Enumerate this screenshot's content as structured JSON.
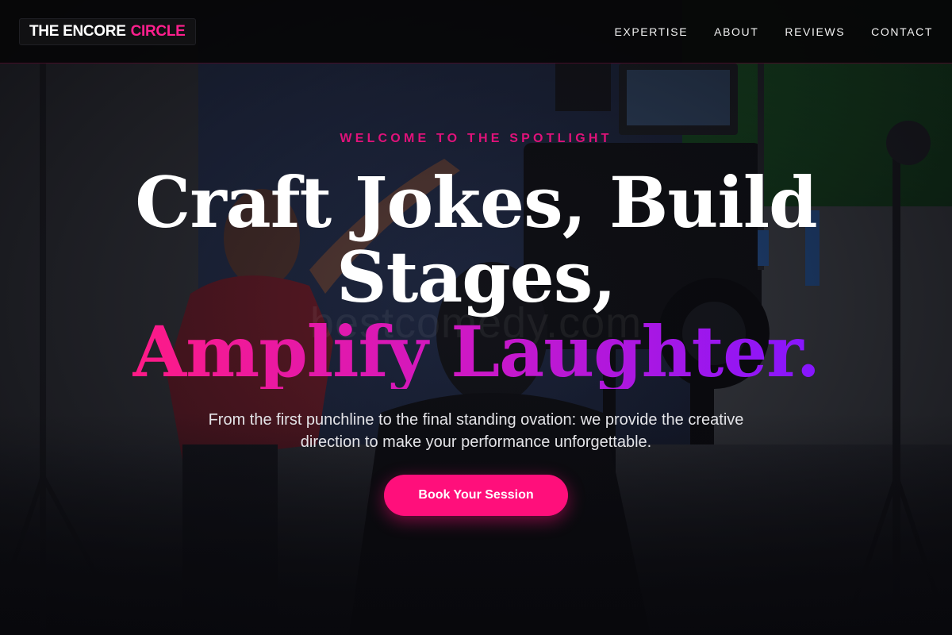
{
  "brand": {
    "name_main": "THE ENCORE",
    "name_accent": "CIRCLE"
  },
  "nav": {
    "items": [
      {
        "label": "EXPERTISE"
      },
      {
        "label": "ABOUT"
      },
      {
        "label": "REVIEWS"
      },
      {
        "label": "CONTACT"
      }
    ]
  },
  "hero": {
    "eyebrow": "WELCOME TO THE SPOTLIGHT",
    "headline_line1": "Craft Jokes, Build",
    "headline_line2": "Stages,",
    "headline_accent": "Amplify Laughter.",
    "subtext": "From the first punchline to the final standing ovation: we provide the creative direction to make your performance unforgettable.",
    "cta_label": "Book Your Session",
    "watermark": "bestcomedy.com"
  },
  "colors": {
    "accent_pink": "#ff0f7b",
    "accent_purple": "#8516ff",
    "header_bg": "#060608"
  },
  "icons": [
    "camera-rig-image",
    "studio-light-stand-image"
  ]
}
